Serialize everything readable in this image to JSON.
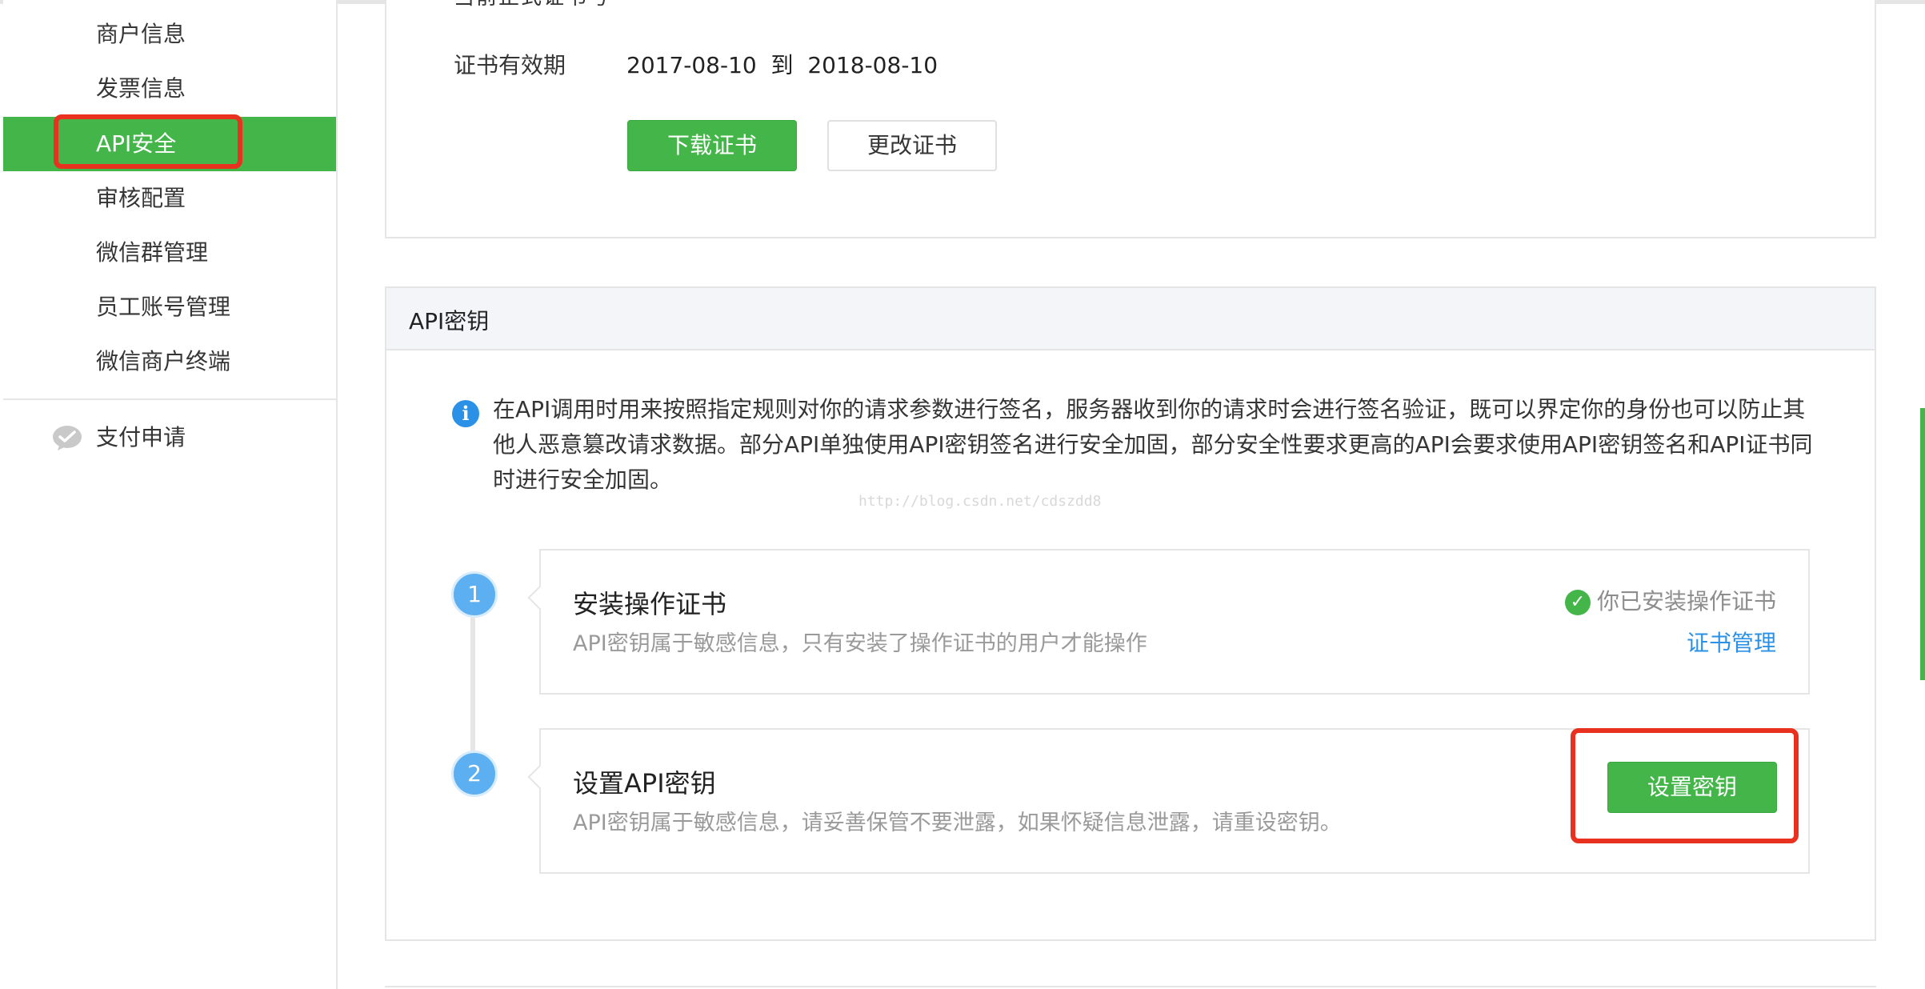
{
  "sidebar": {
    "items": [
      {
        "label": "商户信息"
      },
      {
        "label": "发票信息"
      },
      {
        "label": "API安全"
      },
      {
        "label": "审核配置"
      },
      {
        "label": "微信群管理"
      },
      {
        "label": "员工账号管理"
      },
      {
        "label": "微信商户终端"
      }
    ],
    "active_item": "API安全",
    "pay_apply": {
      "label": "支付申请",
      "icon": "wechat-icon"
    }
  },
  "certificate": {
    "cut_text": "当前正式证书号 ",
    "validity_label": "证书有效期",
    "validity_value": "2017-08-10  到  2018-08-10",
    "download_button": "下载证书",
    "change_button": "更改证书"
  },
  "api_key": {
    "section_title": "API密钥",
    "info_text": "在API调用时用来按照指定规则对你的请求参数进行签名，服务器收到你的请求时会进行签名验证，既可以界定你的身份也可以防止其他人恶意篡改请求数据。部分API单独使用API密钥签名进行安全加固，部分安全性要求更高的API会要求使用API密钥签名和API证书同时进行安全加固。",
    "watermark": "http://blog.csdn.net/cdszdd8",
    "steps": [
      {
        "number": "1",
        "title": "安装操作证书",
        "description": "API密钥属于敏感信息，只有安装了操作证书的用户才能操作",
        "status": "你已安装操作证书",
        "link": "证书管理"
      },
      {
        "number": "2",
        "title": "设置API密钥",
        "description": "API密钥属于敏感信息，请妥善保管不要泄露，如果怀疑信息泄露，请重设密钥。",
        "button": "设置密钥"
      }
    ]
  },
  "colors": {
    "accent_green": "#44b549",
    "link_blue": "#2a91e6",
    "highlight_red": "#e8321f",
    "step_blue": "#5cb0f2"
  }
}
